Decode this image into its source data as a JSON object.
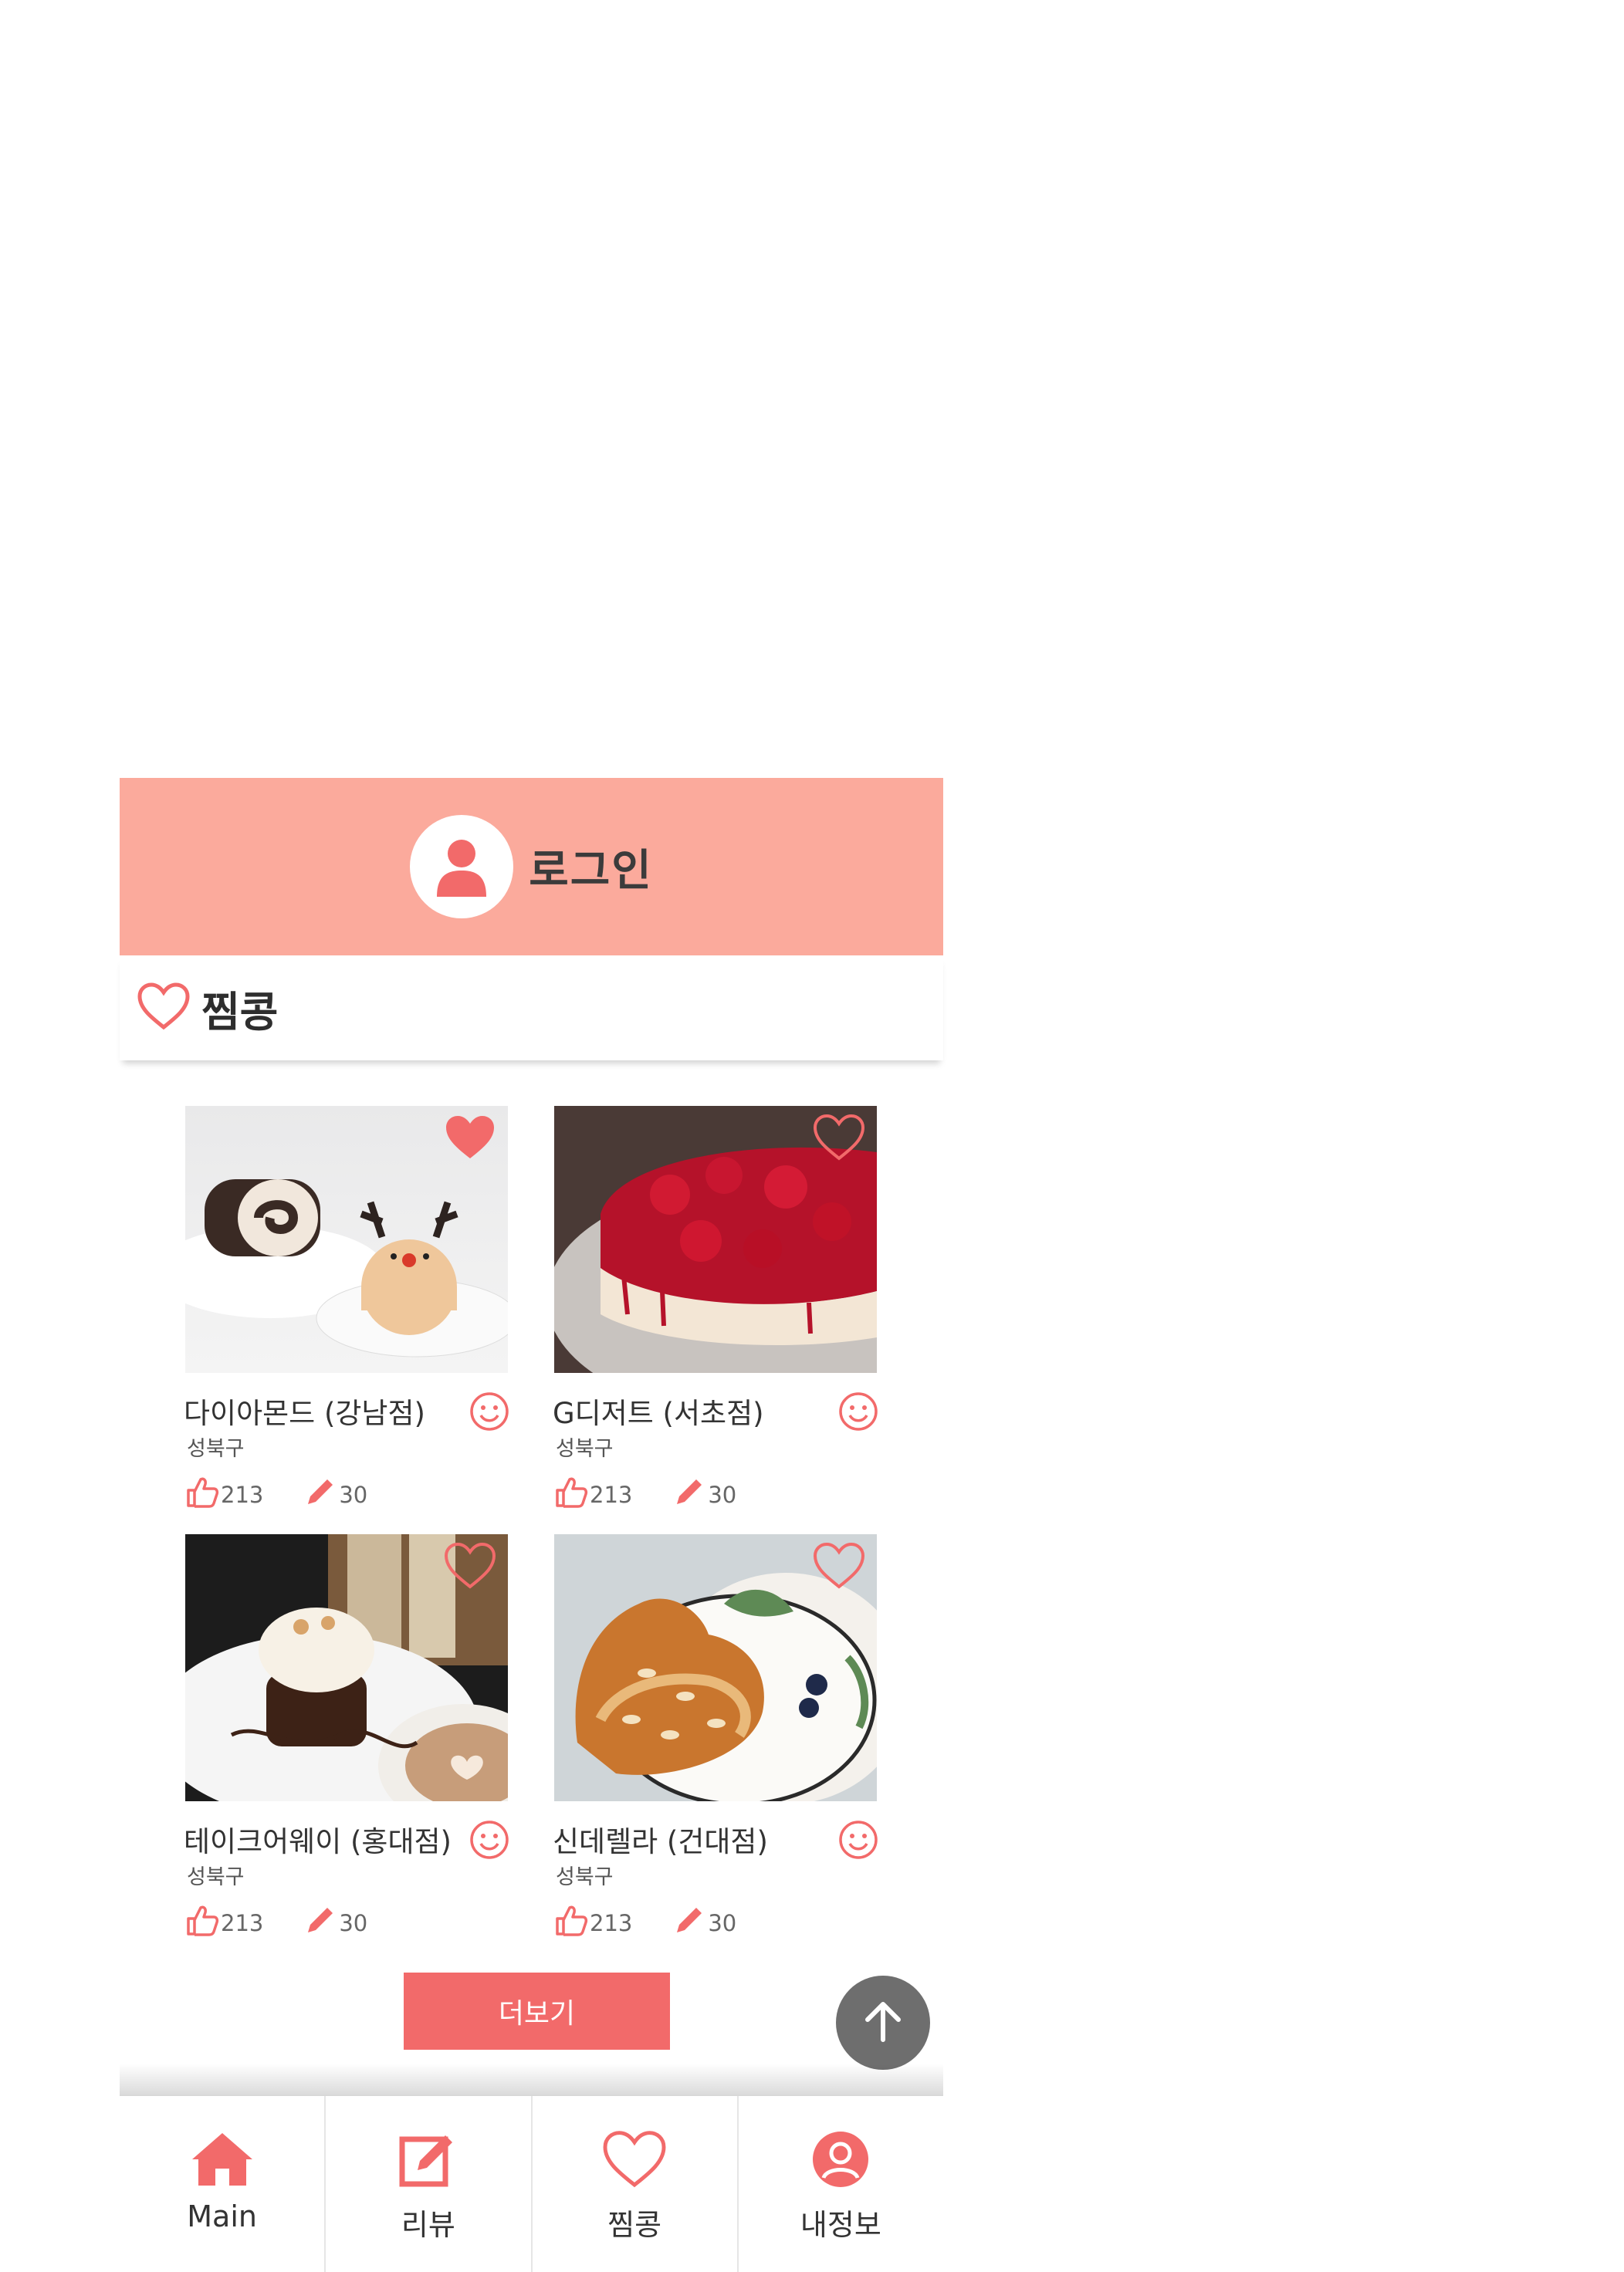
{
  "header": {
    "login_label": "로그인",
    "avatar_icon": "user-icon"
  },
  "section": {
    "title": "찜콩",
    "icon": "heart-outline-icon"
  },
  "accent_color": "#f26a6a",
  "header_color": "#fbaa9c",
  "cards": [
    {
      "name": "다이아몬드 (강남점)",
      "district": "성북구",
      "likes": "213",
      "reviews": "30",
      "favorited": true
    },
    {
      "name": "G디저트 (서초점)",
      "district": "성북구",
      "likes": "213",
      "reviews": "30",
      "favorited": false
    },
    {
      "name": "테이크어웨이 (홍대점)",
      "district": "성북구",
      "likes": "213",
      "reviews": "30",
      "favorited": false
    },
    {
      "name": "신데렐라 (건대점)",
      "district": "성북구",
      "likes": "213",
      "reviews": "30",
      "favorited": false
    }
  ],
  "more_button": {
    "label": "더보기"
  },
  "nav": [
    {
      "label": "Main",
      "icon": "home-icon"
    },
    {
      "label": "리뷰",
      "icon": "edit-icon"
    },
    {
      "label": "찜콩",
      "icon": "heart-icon"
    },
    {
      "label": "내정보",
      "icon": "profile-icon"
    }
  ]
}
